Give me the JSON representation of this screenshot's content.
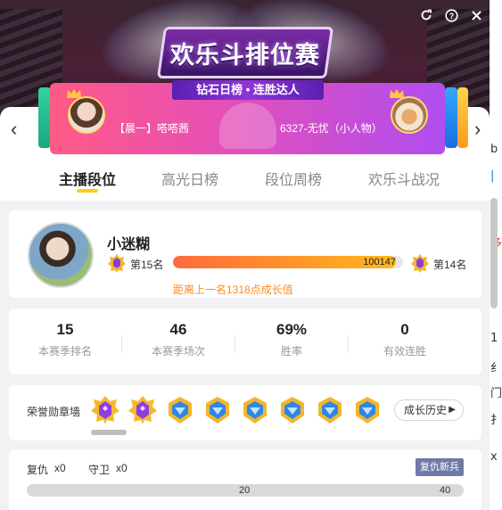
{
  "banner": {
    "logo_text": "欢乐斗排位赛",
    "ribbon_text": "钻石日榜 • 连胜达人",
    "pair_left": "【晨一】嗒嗒茜",
    "pair_right": "6327-无忧（小人物）"
  },
  "window_icons": [
    "refresh-icon",
    "help-icon",
    "close-icon"
  ],
  "tabs": [
    {
      "label": "主播段位",
      "active": true
    },
    {
      "label": "高光日榜",
      "active": false
    },
    {
      "label": "段位周榜",
      "active": false
    },
    {
      "label": "欢乐斗战况",
      "active": false
    }
  ],
  "profile": {
    "name": "小迷糊",
    "rank_current": "第15名",
    "rank_next": "第14名",
    "score": "100147",
    "progress_fraction": 0.97,
    "gap_note": "距离上一名1318点成长值"
  },
  "stats": [
    {
      "value": "15",
      "label": "本赛季排名"
    },
    {
      "value": "46",
      "label": "本赛季场次"
    },
    {
      "value": "69%",
      "label": "胜率"
    },
    {
      "value": "0",
      "label": "有效连胜"
    }
  ],
  "honors": {
    "label": "荣誉勋章墙",
    "badges": [
      "purple-gold",
      "purple-gold",
      "blue-gold",
      "blue-gold",
      "blue-gold",
      "blue-gold",
      "blue-gold",
      "blue-gold"
    ],
    "growth_button": "成长历史"
  },
  "revenge": {
    "revenge_label": "复仇",
    "revenge_count": "x0",
    "guard_label": "守卫",
    "guard_count": "x0",
    "tag": "复仇新兵",
    "bar_mid": "20",
    "bar_end": "40"
  },
  "side_fragments": [
    "b",
    "|",
    "b",
    "多",
    "|",
    "l",
    "1",
    "纟",
    "门",
    "扌",
    "x"
  ]
}
